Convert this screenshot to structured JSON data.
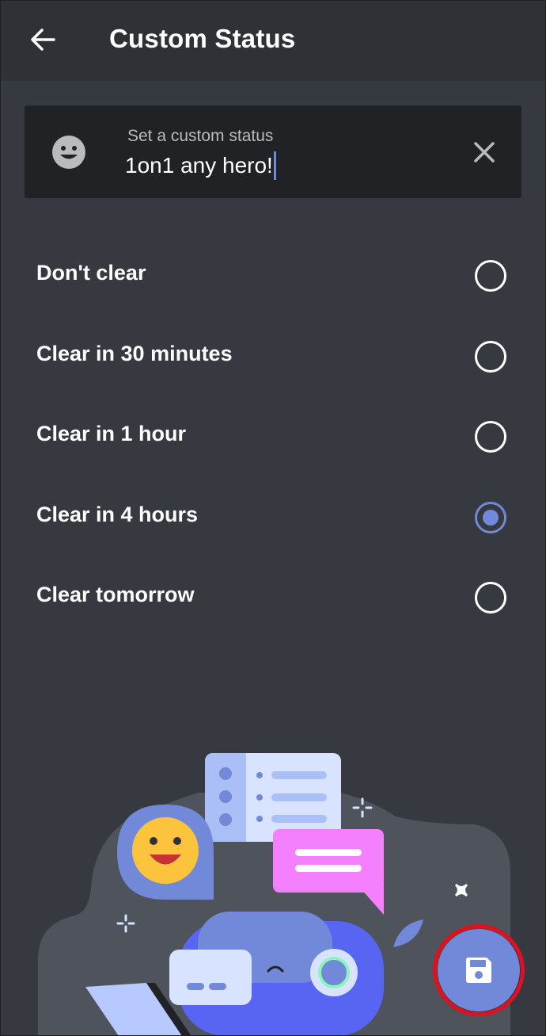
{
  "header": {
    "title": "Custom Status",
    "back_icon": "arrow-left-icon"
  },
  "status": {
    "label": "Set a custom status",
    "value": "1on1 any hero!",
    "emoji_icon": "smiley-face-icon",
    "clear_icon": "close-icon"
  },
  "clear_options": [
    {
      "label": "Don't clear",
      "selected": false
    },
    {
      "label": "Clear in 30 minutes",
      "selected": false
    },
    {
      "label": "Clear in 1 hour",
      "selected": false
    },
    {
      "label": "Clear in 4 hours",
      "selected": true
    },
    {
      "label": "Clear tomorrow",
      "selected": false
    }
  ],
  "save_button": {
    "icon": "floppy-disk-save-icon",
    "highlighted": true
  },
  "colors": {
    "background": "#36393f",
    "header": "#2f3136",
    "input_bg": "#202225",
    "accent": "#7289da",
    "highlight": "#e0101e"
  }
}
